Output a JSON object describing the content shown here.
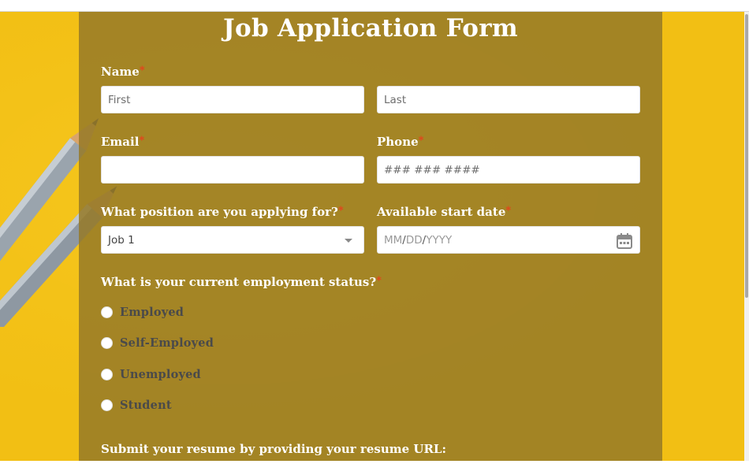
{
  "form": {
    "title": "Job Application Form",
    "required_mark": "*",
    "name": {
      "label": "Name",
      "first_placeholder": "First",
      "last_placeholder": "Last"
    },
    "email": {
      "label": "Email",
      "placeholder": ""
    },
    "phone": {
      "label": "Phone",
      "placeholder": "### ### ####"
    },
    "position": {
      "label": "What position are you applying for?",
      "selected": "Job 1"
    },
    "start_date": {
      "label": "Available start date",
      "placeholder_mm": "MM",
      "placeholder_dd": "DD",
      "placeholder_yyyy": "YYYY",
      "separator": "/",
      "icon": "calendar-icon"
    },
    "employment": {
      "label": "What is your current employment status?",
      "options": [
        {
          "label": "Employed"
        },
        {
          "label": "Self-Employed"
        },
        {
          "label": "Unemployed"
        },
        {
          "label": "Student"
        }
      ]
    },
    "resume": {
      "label": "Submit your resume by providing your resume URL:"
    }
  },
  "colors": {
    "background": "#f2bf14",
    "panel": "#967a28",
    "required": "#e8401c",
    "label": "#ffffff"
  }
}
